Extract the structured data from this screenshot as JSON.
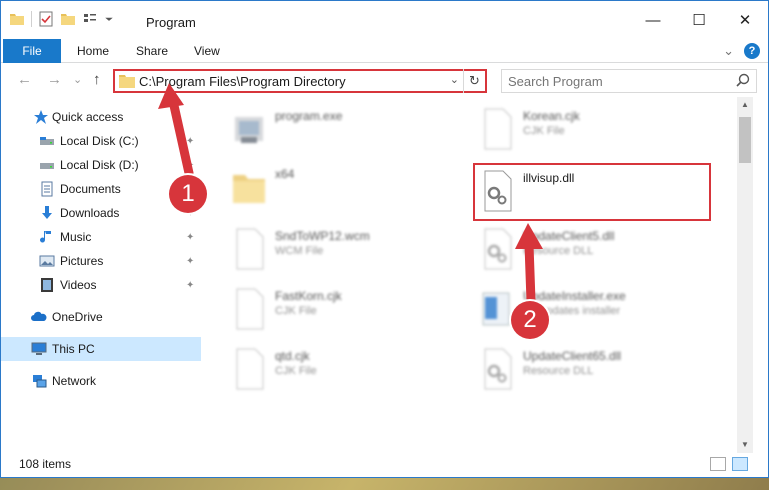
{
  "window": {
    "title": "Program",
    "controls": {
      "minimize": "—",
      "maximize": "☐",
      "close": "✕"
    }
  },
  "ribbon": {
    "tabs": [
      {
        "label": "File"
      },
      {
        "label": "Home"
      },
      {
        "label": "Share"
      },
      {
        "label": "View"
      }
    ],
    "expand_glyph": "⌄",
    "help_glyph": "?"
  },
  "navigation": {
    "back": "←",
    "forward": "→",
    "recent": "⌄",
    "up": "↑"
  },
  "address_bar": {
    "path": "C:\\Program Files\\Program Directory",
    "dropdown_glyph": "⌄",
    "refresh_glyph": "↻"
  },
  "search": {
    "placeholder": "Search Program",
    "icon": "search-icon"
  },
  "sidebar": {
    "items": [
      {
        "label": "Quick access",
        "icon": "star-icon",
        "pinned": false
      },
      {
        "label": "Local Disk (C:)",
        "icon": "drive-icon",
        "pinned": true
      },
      {
        "label": "Local Disk (D:)",
        "icon": "drive-icon",
        "pinned": true
      },
      {
        "label": "Documents",
        "icon": "documents-icon",
        "pinned": true
      },
      {
        "label": "Downloads",
        "icon": "download-icon",
        "pinned": true
      },
      {
        "label": "Music",
        "icon": "music-icon",
        "pinned": true
      },
      {
        "label": "Pictures",
        "icon": "pictures-icon",
        "pinned": true
      },
      {
        "label": "Videos",
        "icon": "videos-icon",
        "pinned": true
      },
      {
        "label": "OneDrive",
        "icon": "cloud-icon",
        "pinned": false
      },
      {
        "label": "This PC",
        "icon": "computer-icon",
        "pinned": false,
        "selected": true
      },
      {
        "label": "Network",
        "icon": "network-icon",
        "pinned": false
      }
    ],
    "pin_glyph": "📌"
  },
  "files": [
    {
      "name": "program.exe",
      "type": "",
      "icon": "exe-icon"
    },
    {
      "name": "Korean.cjk",
      "type": "CJK File",
      "icon": "document-icon"
    },
    {
      "name": "x64",
      "type": "",
      "icon": "folder-icon"
    },
    {
      "name": "illvisup.dll",
      "type": "",
      "icon": "dll-gear-icon"
    },
    {
      "name": "SndToWP12.wcm",
      "type": "WCM File",
      "icon": "document-icon"
    },
    {
      "name": "UpdateClient5.dll",
      "type": "Resource DLL",
      "icon": "dll-gear-icon"
    },
    {
      "name": "FastKorn.cjk",
      "type": "CJK File",
      "icon": "document-icon"
    },
    {
      "name": "UpdateInstaller.exe",
      "type": "EF updates installer",
      "icon": "installer-icon"
    },
    {
      "name": "qtd.cjk",
      "type": "CJK File",
      "icon": "document-icon"
    },
    {
      "name": "UpdateClient65.dll",
      "type": "Resource DLL",
      "icon": "dll-gear-icon"
    }
  ],
  "status": {
    "item_count": "108 items"
  },
  "annotations": {
    "step1": "1",
    "step2": "2",
    "color": "#d7353b"
  },
  "colors": {
    "accent": "#1979ca",
    "selection": "#cce8ff",
    "highlight": "#d7353b"
  }
}
